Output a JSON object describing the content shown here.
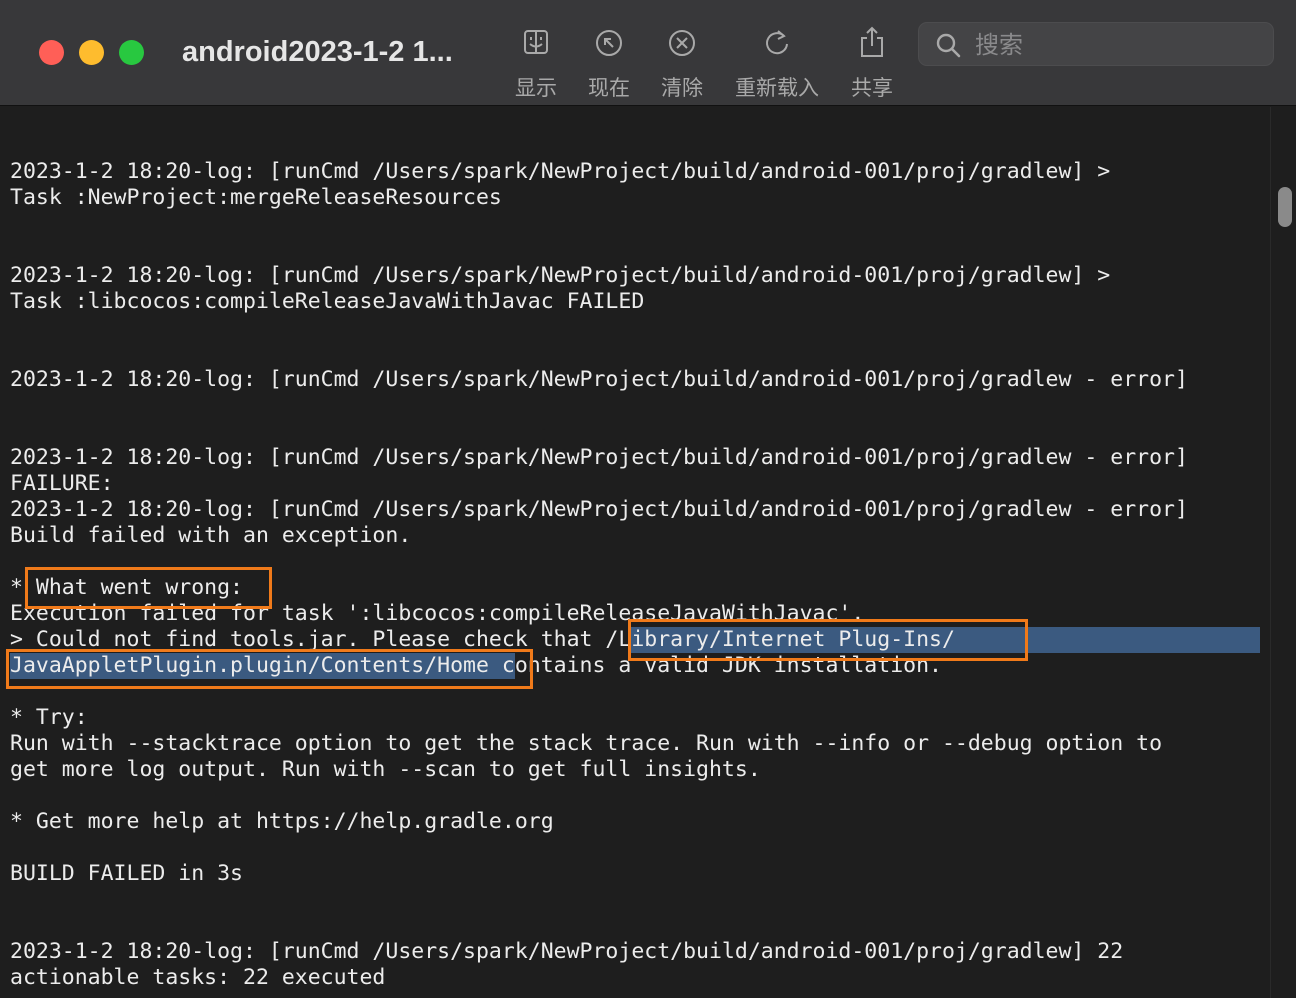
{
  "window": {
    "title": "android2023-1-2 1..."
  },
  "toolbar": {
    "buttons": [
      {
        "label": "显示",
        "icon": "finder-window-icon"
      },
      {
        "label": "现在",
        "icon": "arrow-up-left-circle-icon"
      },
      {
        "label": "清除",
        "icon": "x-circle-icon"
      },
      {
        "label": "重新载入",
        "icon": "reload-icon"
      },
      {
        "label": "共享",
        "icon": "share-icon"
      }
    ],
    "search_placeholder": "搜索"
  },
  "log": {
    "lines": [
      "2023-1-2 18:20-log: [runCmd /Users/spark/NewProject/build/android-001/proj/gradlew] >",
      "Task :NewProject:mergeReleaseResources",
      "",
      "",
      "2023-1-2 18:20-log: [runCmd /Users/spark/NewProject/build/android-001/proj/gradlew] >",
      "Task :libcocos:compileReleaseJavaWithJavac FAILED",
      "",
      "",
      "2023-1-2 18:20-log: [runCmd /Users/spark/NewProject/build/android-001/proj/gradlew - error]",
      "",
      "",
      "2023-1-2 18:20-log: [runCmd /Users/spark/NewProject/build/android-001/proj/gradlew - error]",
      "FAILURE:",
      "2023-1-2 18:20-log: [runCmd /Users/spark/NewProject/build/android-001/proj/gradlew - error]",
      "Build failed with an exception.",
      "",
      "* What went wrong:",
      "Execution failed for task ':libcocos:compileReleaseJavaWithJavac'.",
      "> Could not find tools.jar. Please check that /Library/Internet Plug-Ins/",
      "JavaAppletPlugin.plugin/Contents/Home contains a valid JDK installation.",
      "",
      "* Try:",
      "Run with --stacktrace option to get the stack trace. Run with --info or --debug option to",
      "get more log output. Run with --scan to get full insights.",
      "",
      "* Get more help at https://help.gradle.org",
      "",
      "BUILD FAILED in 3s",
      "",
      "",
      "2023-1-2 18:20-log: [runCmd /Users/spark/NewProject/build/android-001/proj/gradlew] 22",
      "actionable tasks: 22 executed"
    ]
  },
  "colors": {
    "selection": "#3b5a80",
    "annotation": "#f07a1a",
    "text": "#ececec",
    "background": "#1e1e1e"
  }
}
